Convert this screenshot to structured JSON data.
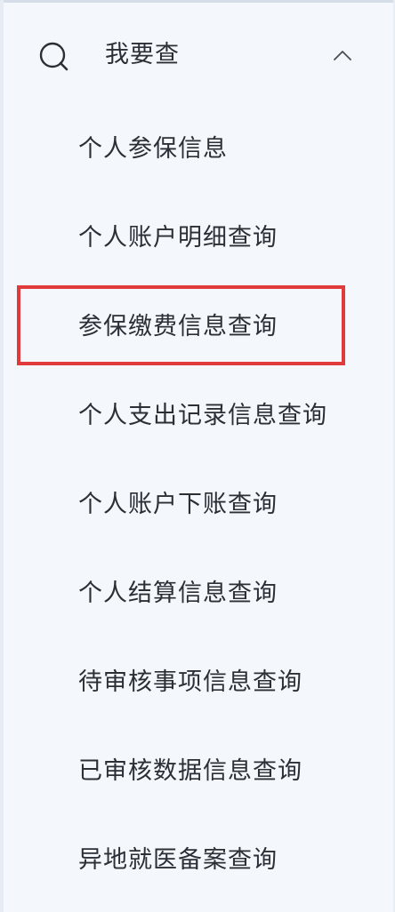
{
  "menu": {
    "header": {
      "label": "我要查",
      "icon": "search-icon",
      "expand_icon": "chevron-up-icon",
      "expanded": true
    },
    "items": [
      {
        "label": "个人参保信息"
      },
      {
        "label": "个人账户明细查询"
      },
      {
        "label": "参保缴费信息查询",
        "highlighted": true
      },
      {
        "label": "个人支出记录信息查询"
      },
      {
        "label": "个人账户下账查询"
      },
      {
        "label": "个人结算信息查询"
      },
      {
        "label": "待审核事项信息查询"
      },
      {
        "label": "已审核数据信息查询"
      },
      {
        "label": "异地就医备案查询"
      }
    ]
  },
  "colors": {
    "background": "#f4f7fb",
    "text": "#2b2f36",
    "highlight_border": "#e03a3a"
  }
}
